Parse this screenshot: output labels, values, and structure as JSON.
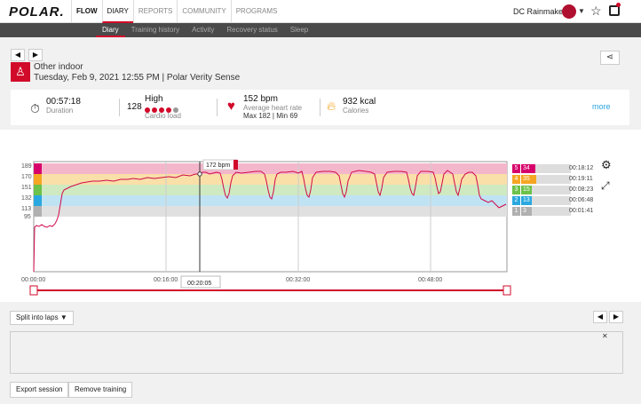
{
  "header": {
    "logo": "POLAR.",
    "nav": [
      "FLOW",
      "DIARY",
      "REPORTS",
      "COMMUNITY",
      "PROGRAMS"
    ],
    "user_name": "DC Rainmaker"
  },
  "subnav": [
    "Diary",
    "Training history",
    "Activity",
    "Recovery status",
    "Sleep"
  ],
  "session": {
    "sport": "Other indoor",
    "datetime": "Tuesday, Feb 9, 2021 12:55 PM | Polar Verity Sense"
  },
  "stats": {
    "duration": "00:57:18",
    "duration_label": "Duration",
    "cardio_value": "128",
    "cardio_level": "High",
    "cardio_label": "Cardio load",
    "cardio_dots_filled": 4,
    "cardio_dots_total": 5,
    "hr": "152 bpm",
    "hr_label": "Average heart rate",
    "hr_minmax": "Max 182  |  Min 69",
    "kcal": "932 kcal",
    "kcal_label": "Calories",
    "more": "more"
  },
  "chart": {
    "y_ticks": [
      "189",
      "170",
      "151",
      "132",
      "113",
      "95"
    ],
    "x_ticks": [
      "00:00:00",
      "00:16:00",
      "00:32:00",
      "00:48:00"
    ],
    "cursor_value": "172 bpm",
    "cursor_time": "00:20:05"
  },
  "zones": [
    {
      "num": "5",
      "pct": "34 %",
      "time": "00:18:12",
      "color": "#d7006b"
    },
    {
      "num": "4",
      "pct": "35 %",
      "time": "00:19:11",
      "color": "#f5a623"
    },
    {
      "num": "3",
      "pct": "15 %",
      "time": "00:08:23",
      "color": "#6cc24a"
    },
    {
      "num": "2",
      "pct": "13 %",
      "time": "00:06:48",
      "color": "#2aa8e0"
    },
    {
      "num": "1",
      "pct": "3 %",
      "time": "00:01:41",
      "color": "#b0b0b0"
    }
  ],
  "zone_colors": {
    "z5": "#f4b6cb",
    "z4": "#f9dfa8",
    "z3": "#cfe9c1",
    "z2": "#bfe3f2",
    "z1": "#e0e0e0"
  },
  "controls": {
    "split_laps": "Split into laps",
    "export": "Export session",
    "remove": "Remove training",
    "close": "✕"
  }
}
